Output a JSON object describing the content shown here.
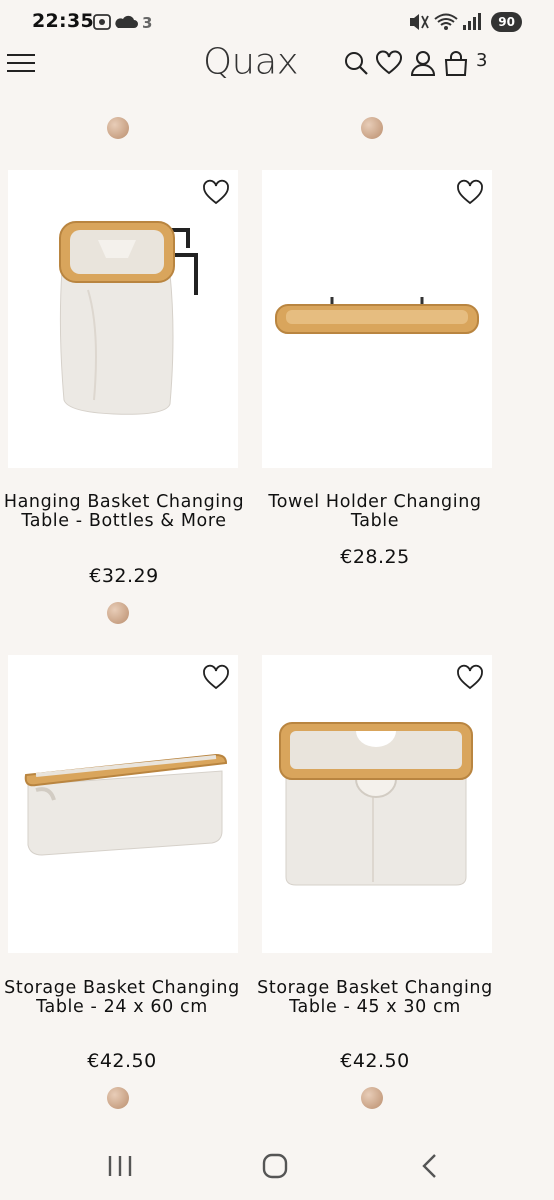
{
  "status_bar": {
    "time": "22:35",
    "battery": "90"
  },
  "header": {
    "logo": "Quax",
    "cart_count": "3"
  },
  "products": [
    {
      "name": "Hanging Basket Changing Table - Bottles & More",
      "price": "€32.29"
    },
    {
      "name": "Towel Holder Changing Table",
      "price": "€28.25"
    },
    {
      "name": "Storage Basket Changing Table - 24 x 60 cm",
      "price": "€42.50"
    },
    {
      "name": "Storage Basket Changing Table - 45 x 30 cm",
      "price": "€42.50"
    }
  ],
  "colors": {
    "background": "#f8f5f2",
    "bamboo": "#d9a55c",
    "fabric": "#ece9e4",
    "swatch": "#c8a184"
  },
  "icons": [
    "menu-icon",
    "search-icon",
    "heart-icon",
    "user-icon",
    "bag-icon",
    "recents-icon",
    "home-icon",
    "back-icon"
  ]
}
